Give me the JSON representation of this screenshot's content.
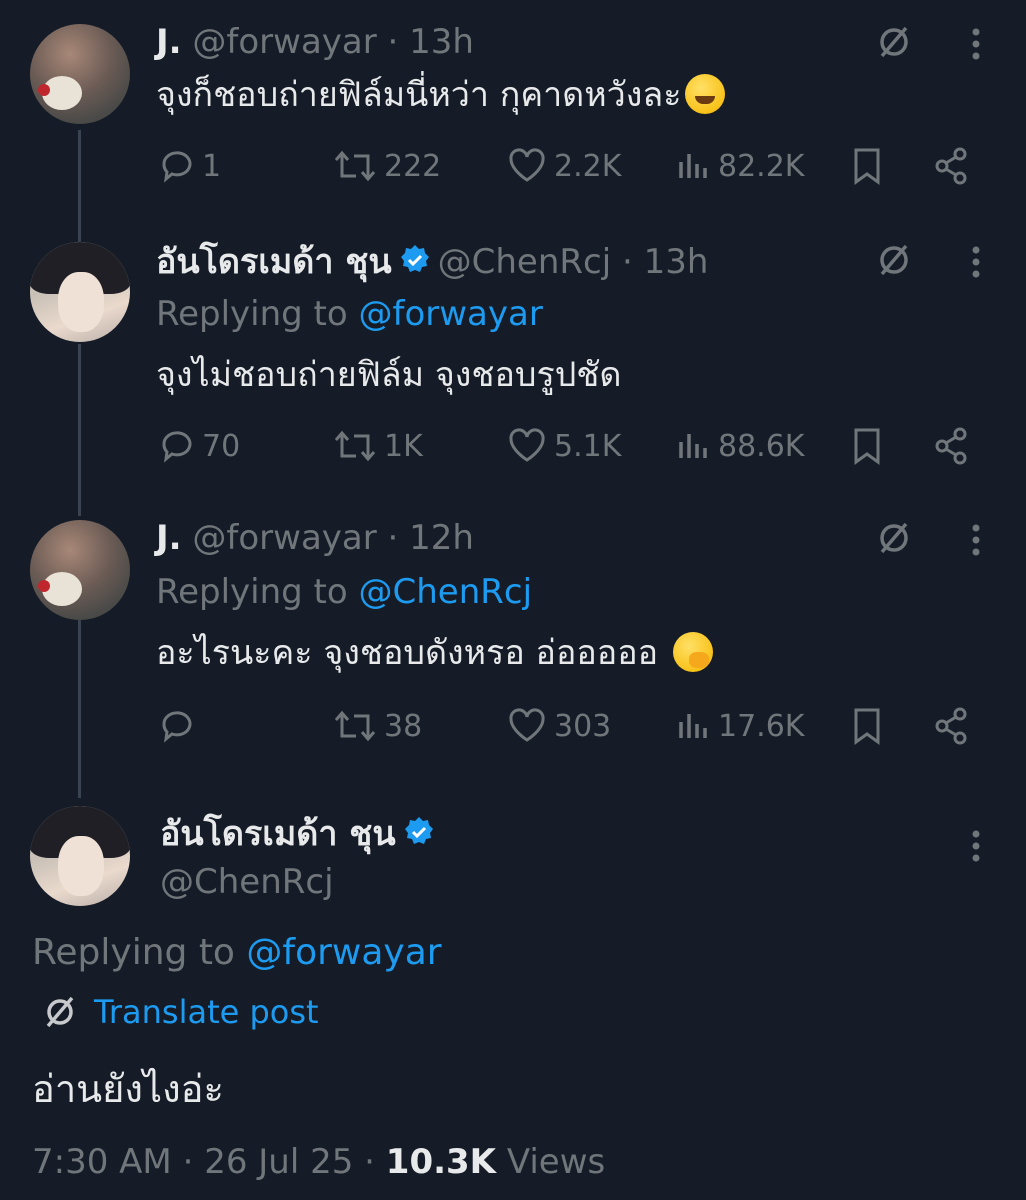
{
  "tweets": [
    {
      "name": "J.",
      "handle": "@forwayar",
      "time": "· 13h",
      "replying_prefix": "",
      "replying_to": "",
      "text": "จุงก็ชอบถ่ายฟิล์มนี่หว่า กุคาดหวังละ",
      "emoji": "joy-emoji",
      "replies": "1",
      "retweets": "222",
      "likes": "2.2K",
      "views": "82.2K",
      "verified": false
    },
    {
      "name": "อันโดรเมด้า ชุน",
      "handle": "@ChenRcj",
      "time": "· 13h",
      "replying_prefix": "Replying to",
      "replying_to": "@forwayar",
      "text": "จุงไม่ชอบถ่ายฟิล์ม จุงชอบรูปชัด",
      "replies": "70",
      "retweets": "1K",
      "likes": "5.1K",
      "views": "88.6K",
      "verified": true
    },
    {
      "name": "J.",
      "handle": "@forwayar",
      "time": "· 12h",
      "replying_prefix": "Replying to",
      "replying_to": "@ChenRcj",
      "text": "อะไรนะคะ จุงชอบดังหรอ อ่อออออ",
      "emoji": "hand-over-mouth-emoji",
      "replies": "",
      "retweets": "38",
      "likes": "303",
      "views": "17.6K",
      "verified": false
    }
  ],
  "main": {
    "name": "อันโดรเมด้า ชุน",
    "handle": "@ChenRcj",
    "replying_prefix": "Replying to",
    "replying_to": "@forwayar",
    "translate": "Translate post",
    "text": "อ่านยังไงอ่ะ",
    "time": "7:30 AM",
    "date": "· 26 Jul 25 ·",
    "views_count": "10.3K",
    "views_label": "Views"
  },
  "colors": {
    "background": "#151c27",
    "text": "#e7e9ea",
    "muted": "#71767b",
    "link": "#1d9bf0",
    "thread_line": "#3a4350"
  }
}
